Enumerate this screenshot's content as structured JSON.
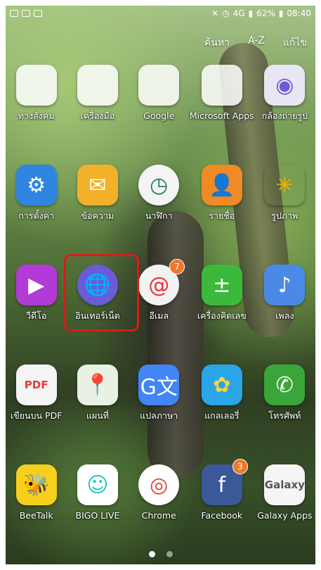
{
  "status_bar": {
    "battery": "62%",
    "time": "08:40",
    "network": "4G"
  },
  "top_actions": {
    "search": "ค้นหา",
    "sort": "A-Z",
    "edit": "แก้ไข"
  },
  "apps": [
    {
      "label": "ทางสังคม",
      "icon": "social-folder-icon",
      "kind": "folder",
      "colors": [
        "#e1306c",
        "#2b8cf0",
        "#fff",
        "#ffffff"
      ]
    },
    {
      "label": "เครื่องมือ",
      "icon": "tools-folder-icon",
      "kind": "folder",
      "colors": [
        "#4aa3f0",
        "#f6b500",
        "#3ec46d",
        "#f19a2b"
      ]
    },
    {
      "label": "Google",
      "icon": "google-folder-icon",
      "kind": "folder",
      "colors": [
        "#ea4335",
        "#fbbc05",
        "#34a853",
        "#4285f4"
      ]
    },
    {
      "label": "Microsoft Apps",
      "icon": "microsoft-folder-icon",
      "kind": "folder",
      "colors": [
        "#2b579a",
        "#217346",
        "#d24726",
        "#0078d4"
      ]
    },
    {
      "label": "กล้องถ่ายรูป",
      "icon": "camera-icon",
      "kind": "app",
      "bg": "#e9e6f3",
      "glyph": "◉",
      "glyph_color": "#6b5cd6"
    },
    {
      "label": "การตั้งค่า",
      "icon": "settings-gear-icon",
      "kind": "app",
      "bg": "#2f86e0",
      "glyph": "⚙"
    },
    {
      "label": "ข้อความ",
      "icon": "messages-envelope-icon",
      "kind": "app",
      "bg": "#f3b12a",
      "glyph": "✉"
    },
    {
      "label": "นาฬิกา",
      "icon": "clock-icon",
      "kind": "app",
      "bg": "#f4f4f4",
      "glyph": "◷",
      "glyph_color": "#1a7a5a",
      "circle": true
    },
    {
      "label": "รายชื่อ",
      "icon": "contacts-person-icon",
      "kind": "app",
      "bg": "#f08a24",
      "glyph": "👤"
    },
    {
      "label": "รูปภาพ",
      "icon": "photos-pinwheel-icon",
      "kind": "app",
      "bg": "transparent",
      "glyph": "✳",
      "glyph_color": "#f4b400"
    },
    {
      "label": "วีดีโอ",
      "icon": "video-play-icon",
      "kind": "app",
      "bg": "#b23ad6",
      "glyph": "▶"
    },
    {
      "label": "อินเทอร์เน็ต",
      "icon": "internet-globe-icon",
      "kind": "app",
      "bg": "#6b5bd8",
      "glyph": "🌐",
      "circle": true
    },
    {
      "label": "อีเมล",
      "icon": "email-at-icon",
      "kind": "app",
      "bg": "#f2f2f2",
      "glyph": "@",
      "glyph_color": "#e8333a",
      "circle": true,
      "badge": "7"
    },
    {
      "label": "เครื่องคิดเลข",
      "icon": "calculator-icon",
      "kind": "app",
      "bg": "#3cb93c",
      "glyph": "±"
    },
    {
      "label": "เพลง",
      "icon": "music-note-icon",
      "kind": "app",
      "bg": "#4a8ae6",
      "glyph": "♪"
    },
    {
      "label": "เขียนบน PDF",
      "icon": "pdf-write-icon",
      "kind": "app",
      "bg": "#f5f5f5",
      "glyph": "PDF",
      "glyph_color": "#e53935"
    },
    {
      "label": "แผนที่",
      "icon": "maps-pin-icon",
      "kind": "app",
      "bg": "#e9f1e4",
      "glyph": "📍",
      "glyph_color": "#d93025"
    },
    {
      "label": "แปลภาษา",
      "icon": "translate-icon",
      "kind": "app",
      "bg": "#4285f4",
      "glyph": "G文"
    },
    {
      "label": "แกลเลอรี่",
      "icon": "gallery-flower-icon",
      "kind": "app",
      "bg": "#2aa6e8",
      "glyph": "✿",
      "glyph_color": "#f9d33a"
    },
    {
      "label": "โทรศัพท์",
      "icon": "phone-icon",
      "kind": "app",
      "bg": "#3aa63a",
      "glyph": "✆"
    },
    {
      "label": "BeeTalk",
      "icon": "beetalk-bee-icon",
      "kind": "app",
      "bg": "#f7cf1d",
      "glyph": "🐝",
      "glyph_color": "#222"
    },
    {
      "label": "BIGO LIVE",
      "icon": "bigo-live-icon",
      "kind": "app",
      "bg": "#ffffff",
      "glyph": "☺",
      "glyph_color": "#1fc9c0"
    },
    {
      "label": "Chrome",
      "icon": "chrome-icon",
      "kind": "app",
      "bg": "#ffffff",
      "glyph": "◎",
      "glyph_color": "#db4437",
      "circle": true
    },
    {
      "label": "Facebook",
      "icon": "facebook-icon",
      "kind": "app",
      "bg": "#3b5998",
      "glyph": "f",
      "badge": "3"
    },
    {
      "label": "Galaxy Apps",
      "icon": "galaxy-apps-icon",
      "kind": "app",
      "bg": "#f5f5f5",
      "glyph": "Galaxy",
      "glyph_color": "#555"
    }
  ],
  "page_indicator": {
    "pages": 2,
    "current": 1
  }
}
